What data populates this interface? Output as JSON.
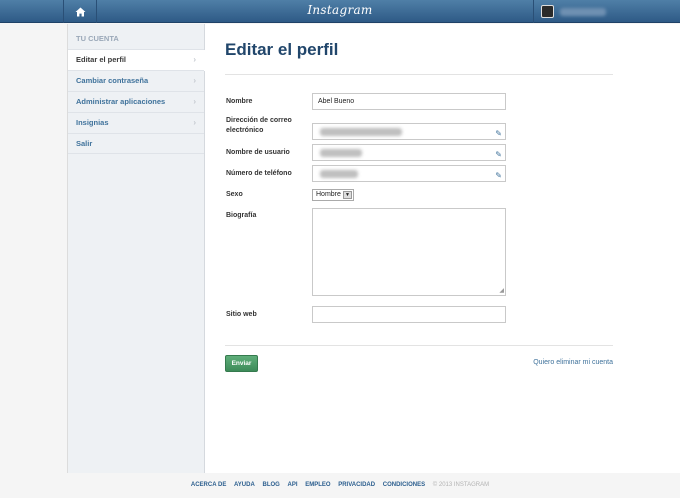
{
  "topbar": {
    "logo": "Instagram",
    "home_icon": "home-icon",
    "user_avatar": "avatar"
  },
  "sidebar": {
    "header": "TU CUENTA",
    "items": [
      {
        "label": "Editar el perfil",
        "active": true
      },
      {
        "label": "Cambiar contraseña"
      },
      {
        "label": "Administrar aplicaciones"
      },
      {
        "label": "Insignias"
      },
      {
        "label": "Salir"
      }
    ]
  },
  "main": {
    "title": "Editar el perfil",
    "fields": {
      "name_label": "Nombre",
      "name_value": "Abel Bueno",
      "email_label": "Dirección de correo electrónico",
      "username_label": "Nombre de usuario",
      "phone_label": "Número de teléfono",
      "sex_label": "Sexo",
      "sex_value": "Hombre",
      "bio_label": "Biografía",
      "website_label": "Sitio web"
    },
    "submit_label": "Enviar",
    "delete_link": "Quiero eliminar mi cuenta"
  },
  "footer": {
    "links": [
      "ACERCA DE",
      "AYUDA",
      "BLOG",
      "API",
      "EMPLEO",
      "PRIVACIDAD",
      "CONDICIONES"
    ],
    "copyright": "© 2013 INSTAGRAM"
  },
  "colors": {
    "topbar": "#3f6b96",
    "link": "#3f729b",
    "title": "#21466b",
    "submit": "#4a9a66"
  }
}
